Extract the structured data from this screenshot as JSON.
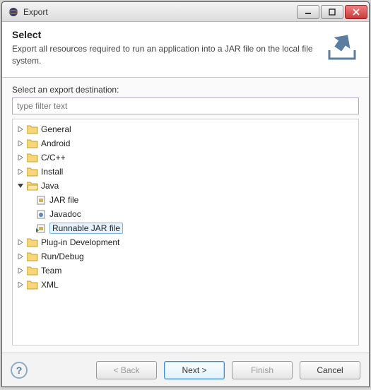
{
  "window": {
    "title": "Export"
  },
  "header": {
    "title": "Select",
    "description": "Export all resources required to run an application into a JAR file on the local file system."
  },
  "body": {
    "destination_label": "Select an export destination:",
    "filter_placeholder": "type filter text"
  },
  "tree": {
    "general": "General",
    "android": "Android",
    "ccpp": "C/C++",
    "install": "Install",
    "java": "Java",
    "java_jar": "JAR file",
    "java_javadoc": "Javadoc",
    "java_runnable": "Runnable JAR file",
    "plugin": "Plug-in Development",
    "rundebug": "Run/Debug",
    "team": "Team",
    "xml": "XML"
  },
  "buttons": {
    "back": "< Back",
    "next": "Next >",
    "finish": "Finish",
    "cancel": "Cancel"
  }
}
